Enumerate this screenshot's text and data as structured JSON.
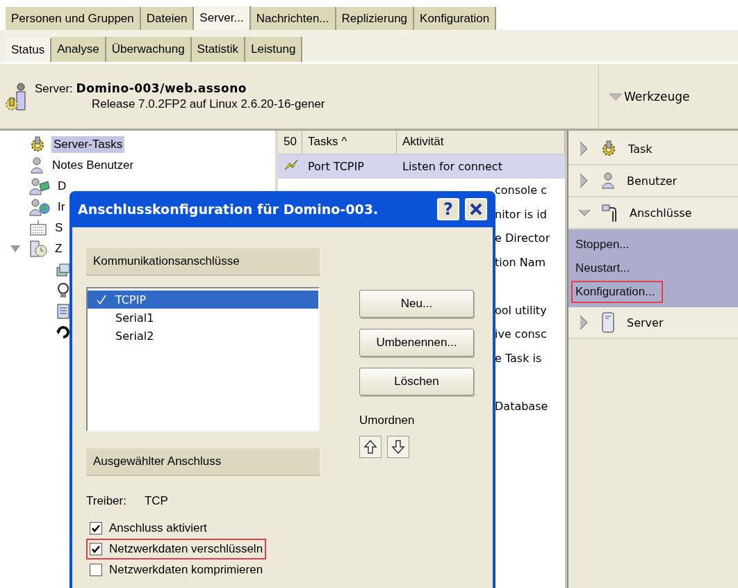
{
  "main_tabs": [
    {
      "label": "Personen und Gruppen",
      "selected": false
    },
    {
      "label": "Dateien",
      "selected": false
    },
    {
      "label": "Server...",
      "selected": true
    },
    {
      "label": "Nachrichten...",
      "selected": false
    },
    {
      "label": "Replizierung",
      "selected": false
    },
    {
      "label": "Konfiguration",
      "selected": false
    }
  ],
  "sub_tabs": [
    {
      "label": "Status",
      "selected": true
    },
    {
      "label": "Analyse",
      "selected": false
    },
    {
      "label": "Überwachung",
      "selected": false
    },
    {
      "label": "Statistik",
      "selected": false
    },
    {
      "label": "Leistung",
      "selected": false
    }
  ],
  "server": {
    "label": "Server:",
    "name": "Domino-003/web.assono",
    "release": "Release 7.0.2FP2 auf Linux 2.6.20-16-gener"
  },
  "tools_toggle": {
    "label": "Werkzeuge",
    "expanded": true
  },
  "tree": [
    {
      "label": "Server-Tasks",
      "kind": "gear",
      "selected": true
    },
    {
      "label": "Notes Benutzer",
      "kind": "person",
      "selected": false
    },
    {
      "label": "D",
      "kind": "group",
      "selected": false
    },
    {
      "label": "Ir",
      "kind": "globe",
      "selected": false
    },
    {
      "label": "S",
      "kind": "keyboard",
      "selected": false
    },
    {
      "label": "Z",
      "kind": "server",
      "selected": false,
      "expanded": true,
      "children": [
        {
          "kind": "stack"
        },
        {
          "kind": "bulb"
        },
        {
          "kind": "doc"
        },
        {
          "kind": "cycle"
        }
      ]
    }
  ],
  "table": {
    "columns": [
      "50",
      "Tasks ^",
      "Aktivität"
    ],
    "rows": [
      {
        "task": "Port TCPIP",
        "activity": "Listen for connect",
        "selected": true
      },
      {
        "activity": "console c",
        "selected": false
      },
      {
        "activity": "nitor is id",
        "selected": false
      },
      {
        "activity": "e Director",
        "selected": false
      },
      {
        "activity": "tion Nam",
        "selected": false
      },
      {
        "selected": false
      },
      {
        "activity": "ool utility",
        "selected": false
      },
      {
        "activity": "ive consc",
        "selected": false
      },
      {
        "activity": "e Task is",
        "selected": false
      },
      {
        "selected": false
      },
      {
        "activity": "Database",
        "selected": false
      }
    ]
  },
  "tools": [
    {
      "label": "Task",
      "kind": "gear",
      "expanded": false
    },
    {
      "label": "Benutzer",
      "kind": "person",
      "expanded": false
    },
    {
      "label": "Anschlüsse",
      "kind": "plug",
      "expanded": true,
      "actions": [
        {
          "label": "Stoppen...",
          "highlighted": false
        },
        {
          "label": "Neustart...",
          "highlighted": false
        },
        {
          "label": "Konfiguration...",
          "highlighted": true
        }
      ]
    },
    {
      "label": "Server",
      "kind": "server",
      "expanded": false
    }
  ],
  "dialog": {
    "title": "Anschlusskonfiguration für Domino-003.",
    "help": "?",
    "ports_header": "Kommunikationsanschlüsse",
    "ports": [
      {
        "name": "TCPIP",
        "enabled": true,
        "selected": true
      },
      {
        "name": "Serial1",
        "enabled": false,
        "selected": false
      },
      {
        "name": "Serial2",
        "enabled": false,
        "selected": false
      }
    ],
    "buttons": [
      "Neu...",
      "Umbenennen...",
      "Löschen"
    ],
    "reorder_label": "Umordnen",
    "selected_header": "Ausgewählter Anschluss",
    "driver_label": "Treiber:",
    "driver": "TCP",
    "options": [
      {
        "label": "Anschluss aktiviert",
        "checked": true,
        "highlighted": false
      },
      {
        "label": "Netzwerkdaten verschlüsseln",
        "checked": true,
        "highlighted": true
      },
      {
        "label": "Netzwerkdaten komprimieren",
        "checked": false,
        "highlighted": false
      }
    ]
  }
}
